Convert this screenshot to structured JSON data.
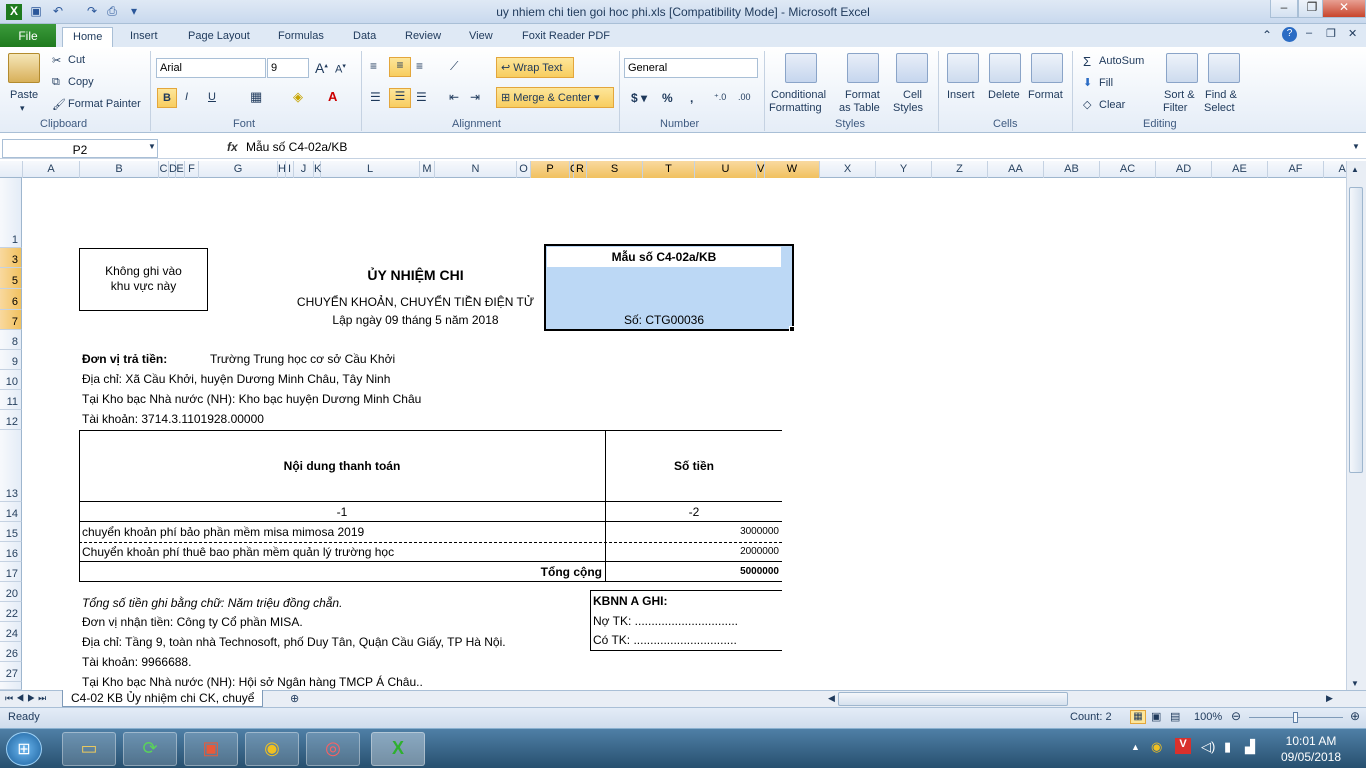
{
  "window": {
    "title": "uy nhiem chi tien goi hoc phi.xls  [Compatibility Mode]  -  Microsoft Excel"
  },
  "tabs": [
    "File",
    "Home",
    "Insert",
    "Page Layout",
    "Formulas",
    "Data",
    "Review",
    "View",
    "Foxit Reader PDF"
  ],
  "ribbon": {
    "clipboard": {
      "paste": "Paste",
      "cut": "Cut",
      "copy": "Copy",
      "format_painter": "Format Painter",
      "label": "Clipboard"
    },
    "font": {
      "name": "Arial",
      "size": "9",
      "label": "Font"
    },
    "alignment": {
      "wrap": "Wrap Text",
      "merge": "Merge & Center",
      "label": "Alignment"
    },
    "number": {
      "format": "General",
      "label": "Number"
    },
    "styles": {
      "conditional": "Conditional",
      "conditional2": "Formatting",
      "format_as": "Format",
      "format_as2": "as Table",
      "cell_styles": "Cell",
      "cell_styles2": "Styles",
      "label": "Styles"
    },
    "cells": {
      "insert": "Insert",
      "delete": "Delete",
      "format": "Format",
      "label": "Cells"
    },
    "editing": {
      "autosum": "AutoSum",
      "fill": "Fill",
      "clear": "Clear",
      "sort": "Sort &",
      "sort2": "Filter",
      "find": "Find &",
      "find2": "Select",
      "label": "Editing"
    }
  },
  "formula_bar": {
    "name_box": "P2",
    "fx": "fx",
    "content": "Mẫu số C4-02a/KB"
  },
  "columns": [
    "A",
    "B",
    "C",
    "D",
    "E",
    "F",
    "G",
    "H",
    "I",
    "J",
    "K",
    "L",
    "M",
    "N",
    "O",
    "P",
    "Q",
    "R",
    "S",
    "T",
    "U",
    "V",
    "W",
    "X",
    "Y",
    "Z",
    "AA",
    "AB",
    "AC",
    "AD",
    "AE",
    "AF",
    "AG"
  ],
  "rows": [
    "1",
    "3",
    "5",
    "6",
    "7",
    "8",
    "9",
    "10",
    "11",
    "12",
    "13",
    "14",
    "15",
    "16",
    "17",
    "20",
    "22",
    "24",
    "26",
    "27"
  ],
  "sheet": {
    "stamp_box": [
      "Không ghi vào",
      "khu vực này"
    ],
    "title": "ỦY NHIỆM CHI",
    "subtitle": "CHUYỂN KHOẢN, CHUYỂN TIỀN ĐIỆN TỬ",
    "date": "Lập ngày 09 tháng 5 năm 2018",
    "form_no": "Mẫu số C4-02a/KB",
    "doc_no": "Số: CTG00036",
    "payer_label": "Đơn vị trả tiền:",
    "payer": "Trường Trung học cơ sở Cầu Khởi",
    "address": "Địa chỉ: Xã Cầu Khởi, huyện Dương Minh Châu, Tây Ninh",
    "treasury": "Tại Kho bạc Nhà nước (NH): Kho bạc huyện Dương Minh Châu",
    "account": "Tài khoản: 3714.3.1101928.00000",
    "table": {
      "h1": "Nội dung thanh toán",
      "h2": "Số tiền",
      "idx1": "-1",
      "idx2": "-2",
      "rows": [
        {
          "desc": "chuyển khoản phí bảo phần mềm misa mimosa 2019",
          "amt": "3000000"
        },
        {
          "desc": "Chuyển khoản phí thuê bao phần mềm quản lý trường học",
          "amt": "2000000"
        }
      ],
      "total_label": "Tổng cộng",
      "total": "5000000"
    },
    "words": "Tổng số tiền ghi bằng chữ: Năm triệu đồng chẵn.",
    "payee": "Đơn vị nhận tiền: Công ty Cổ phần MISA.",
    "payee_addr": "Địa chỉ: Tầng 9, toàn nhà Technosoft, phố Duy Tân, Quận Cầu Giấy, TP Hà Nội.",
    "payee_acct": "Tài khoản: 9966688.",
    "payee_bank": "Tại Kho bạc Nhà nước (NH): Hội sở Ngân hàng TMCP Á Châu..",
    "kbnn": {
      "title": "KBNN A GHI:",
      "no": "Nợ TK: ...............................",
      "co": "Có TK: ..............................."
    }
  },
  "sheet_tab": "C4-02 KB Ủy nhiệm chi CK, chuyể",
  "status": {
    "ready": "Ready",
    "count": "Count: 2",
    "zoom": "100%"
  },
  "taskbar": {
    "time": "10:01 AM",
    "date": "09/05/2018"
  },
  "colors": {
    "selection": "#bcd8f5",
    "ribbon_accent": "#2b579a",
    "file_tab": "#1f7a1f"
  }
}
